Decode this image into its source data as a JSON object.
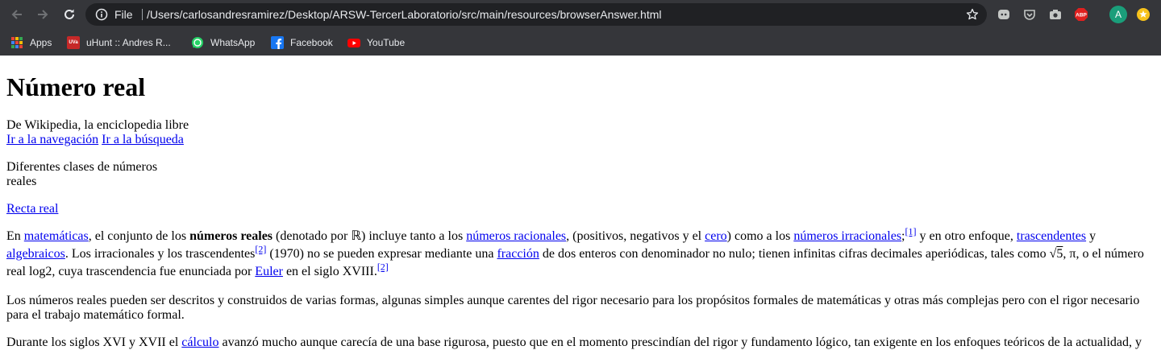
{
  "browser": {
    "scheme_label": "File",
    "url": "/Users/carlosandresramirez/Desktop/ARSW-TercerLaboratorio/src/main/resources/browserAnswer.html",
    "profile_initial": "A",
    "abp_label": "ABP",
    "colors": {
      "chrome_bg": "#35363a",
      "omnibox_bg": "#202124",
      "text": "#e8eaed",
      "profile": "#1a9e7a"
    }
  },
  "bookmarks": [
    {
      "label": "Apps",
      "icon": "apps-grid-icon"
    },
    {
      "label": "uHunt :: Andres R...",
      "icon": "uva-icon",
      "icon_text": "UVa"
    },
    {
      "label": "WhatsApp",
      "icon": "whatsapp-icon"
    },
    {
      "label": "Facebook",
      "icon": "facebook-icon"
    },
    {
      "label": "YouTube",
      "icon": "youtube-icon"
    }
  ],
  "article": {
    "title": "Número real",
    "subtitle": "De Wikipedia, la enciclopedia libre",
    "skip_nav": "Ir a la navegación",
    "skip_search": "Ir a la búsqueda",
    "image_caption_1": "Diferentes clases de números",
    "image_caption_2": "reales",
    "recta_link": "Recta real",
    "p1": {
      "t1": "En ",
      "l_matematicas": "matemáticas",
      "t2": ", el conjunto de los ",
      "b_reales": "números reales",
      "t3": " (denotado por ℝ) incluye tanto a los ",
      "l_racionales": "números racionales",
      "t4": ", (positivos, negativos y el ",
      "l_cero": "cero",
      "t5": ") como a los ",
      "l_irracionales": "números irracionales",
      "t6": ";",
      "ref1": "[1]",
      "t7": " y en otro enfoque, ",
      "l_trascendentes": "trascendentes",
      "t8": " y ",
      "l_algebraicos": "algebraicos",
      "t9": ". Los irracionales y los trascendentes",
      "ref2": "[2]",
      "t10": " (1970) no se pueden expresar mediante una ",
      "l_fraccion": "fracción",
      "t11": " de dos enteros con denominador no nulo; tienen infinitas cifras decimales aperiódicas, tales como √",
      "sqrt_arg": "5",
      "t12": ", π, o el número real log2, cuya trascendencia fue enunciada por ",
      "l_euler": "Euler",
      "t13": " en el siglo XVIII.",
      "ref3": "[2]"
    },
    "p2": "Los números reales pueden ser descritos y construidos de varias formas, algunas simples aunque carentes del rigor necesario para los propósitos formales de matemáticas y otras más complejas pero con el rigor necesario para el trabajo matemático formal.",
    "p3": {
      "t1": "Durante los siglos XVI y XVII el ",
      "l_calculo": "cálculo",
      "t2": " avanzó mucho aunque carecía de una base rigurosa, puesto que en el momento prescindían del rigor y fundamento lógico, tan exigente en los enfoques teóricos de la actualidad, y"
    }
  }
}
